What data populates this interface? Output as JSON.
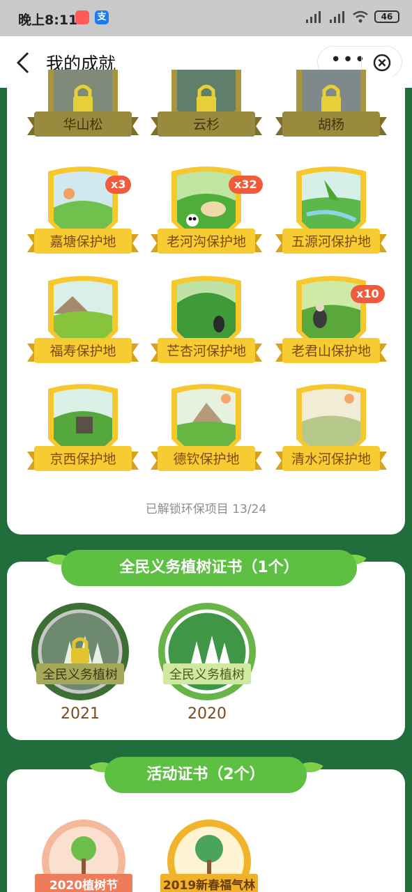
{
  "status_bar": {
    "time": "晚上8:11",
    "battery": "46",
    "app2_glyph": "支"
  },
  "header": {
    "title": "我的成就",
    "more": "•••"
  },
  "locked_row": [
    {
      "label": "华山松"
    },
    {
      "label": "云杉"
    },
    {
      "label": "胡杨"
    }
  ],
  "reserves": [
    {
      "label": "嘉塘保护地",
      "count": "x3"
    },
    {
      "label": "老河沟保护地",
      "count": "x32"
    },
    {
      "label": "五源河保护地",
      "count": ""
    },
    {
      "label": "福寿保护地",
      "count": ""
    },
    {
      "label": "芒杏河保护地",
      "count": ""
    },
    {
      "label": "老君山保护地",
      "count": "x10"
    },
    {
      "label": "京西保护地",
      "count": ""
    },
    {
      "label": "德钦保护地",
      "count": ""
    },
    {
      "label": "清水河保护地",
      "count": ""
    }
  ],
  "summary": "已解锁环保项目 13/24",
  "tree_cert": {
    "title": "全民义务植树证书（1个）",
    "items": [
      {
        "label": "全民义务植树",
        "year": "2021",
        "locked": true
      },
      {
        "label": "全民义务植树",
        "year": "2020",
        "locked": false
      }
    ]
  },
  "activity_cert": {
    "title": "活动证书（2个）",
    "items": [
      {
        "label": "2020植树节"
      },
      {
        "label": "2019新春福气林"
      }
    ]
  },
  "colors": {
    "page_bg": "#1f6e3c",
    "gold": "#f7cc32",
    "green_pill": "#5dc043",
    "badge_count": "#f15a3a"
  }
}
